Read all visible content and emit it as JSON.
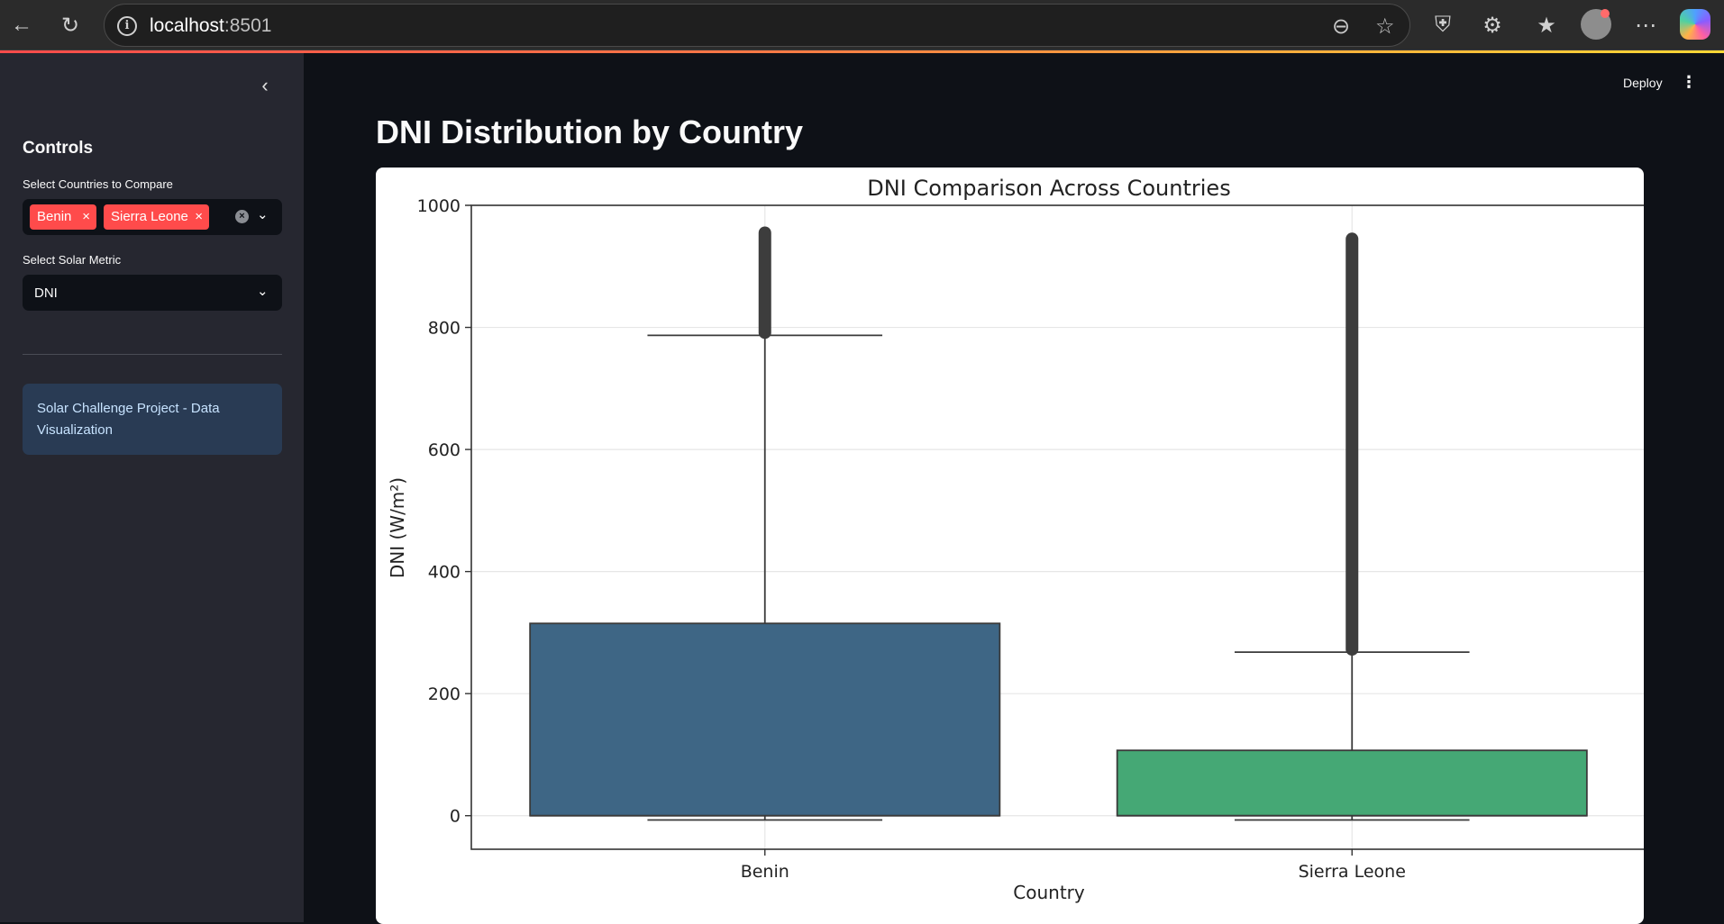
{
  "browser": {
    "url_host": "localhost",
    "url_port": ":8501"
  },
  "sidebar": {
    "heading": "Controls",
    "countries_label": "Select Countries to Compare",
    "selected_countries": [
      "Benin",
      "Sierra Leone"
    ],
    "metric_label": "Select Solar Metric",
    "metric_value": "DNI",
    "info_text": "Solar Challenge Project - Data Visualization"
  },
  "header": {
    "deploy_label": "Deploy"
  },
  "main": {
    "title": "DNI Distribution by Country"
  },
  "colors": {
    "accent": "#ff4b4b",
    "benin_box": "#3e6685",
    "sierra_leone_box": "#45a875",
    "info_bg": "#293b54"
  },
  "chart_data": {
    "type": "box",
    "title": "DNI Comparison Across Countries",
    "xlabel": "Country",
    "ylabel": "DNI (W/m²)",
    "ylim": [
      -55,
      1000
    ],
    "yticks": [
      0,
      200,
      400,
      600,
      800,
      1000
    ],
    "grid": true,
    "categories": [
      "Benin",
      "Sierra Leone"
    ],
    "boxes": [
      {
        "category": "Benin",
        "whisker_low": -7,
        "q1": 0,
        "median": 0,
        "q3": 315,
        "whisker_high": 787,
        "outliers_range": [
          787,
          955
        ]
      },
      {
        "category": "Sierra Leone",
        "whisker_low": -7,
        "q1": 0,
        "median": 0,
        "q3": 107,
        "whisker_high": 268,
        "outliers_range": [
          268,
          945
        ]
      }
    ]
  }
}
